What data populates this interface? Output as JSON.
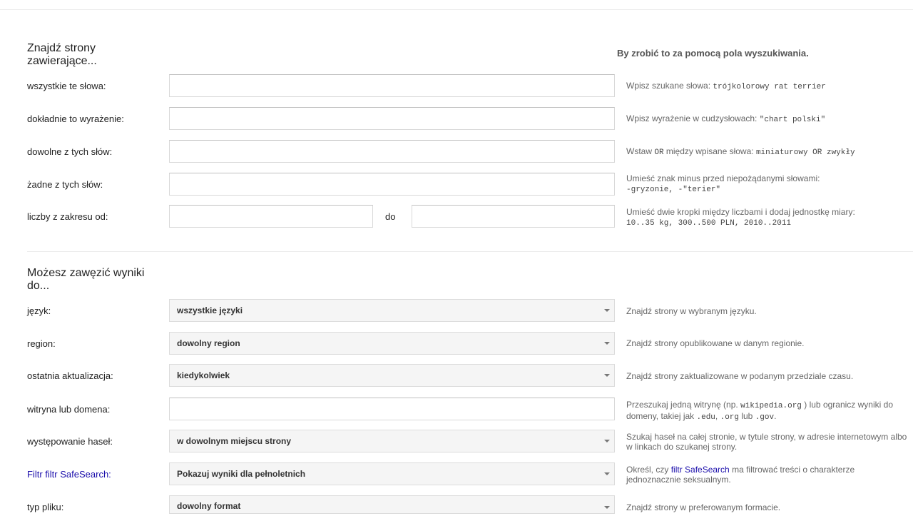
{
  "section1": {
    "title": "Znajdź strony zawierające...",
    "right_title": "By zrobić to za pomocą pola wyszukiwania.",
    "rows": [
      {
        "label": "wszystkie te słowa:",
        "hint_text": "Wpisz szukane słowa:",
        "hint_code": "trójkolorowy rat terrier"
      },
      {
        "label": "dokładnie to wyrażenie:",
        "hint_text": "Wpisz wyrażenie w cudzysłowach:",
        "hint_code": "\"chart polski\""
      },
      {
        "label": "dowolne z tych słów:",
        "hint_pre": "Wstaw",
        "hint_or": "OR",
        "hint_text": "między wpisane słowa:",
        "hint_code": "miniaturowy OR zwykły"
      },
      {
        "label": "żadne z tych słów:",
        "hint_text": "Umieść znak minus przed niepożądanymi słowami:",
        "hint_code": "-gryzonie, -\"terier\""
      },
      {
        "label": "liczby z zakresu od:",
        "to_label": "do",
        "hint_text": "Umieść dwie kropki między liczbami i dodaj jednostkę miary:",
        "hint_code": "10..35 kg, 300..500 PLN, 2010..2011"
      }
    ]
  },
  "section2": {
    "title": "Możesz zawęzić wyniki do...",
    "language": {
      "label": "język:",
      "value": "wszystkie języki",
      "hint": "Znajdź strony w wybranym języku."
    },
    "region": {
      "label": "region:",
      "value": "dowolny region",
      "hint": "Znajdź strony opublikowane w danym regionie."
    },
    "last_update": {
      "label": "ostatnia aktualizacja:",
      "value": "kiedykolwiek",
      "hint": "Znajdź strony zaktualizowane w podanym przedziale czasu."
    },
    "site": {
      "label": "witryna lub domena:",
      "hint_a": "Przeszukaj jedną witrynę (np.",
      "hint_code1": "wikipedia.org",
      "hint_b": ") lub ogranicz wyniki do domeny, takiej jak",
      "hint_code2": ".edu",
      "hint_c": ",",
      "hint_code3": ".org",
      "hint_d": "lub",
      "hint_code4": ".gov",
      "hint_e": "."
    },
    "occurrence": {
      "label": "występowanie haseł:",
      "value": "w dowolnym miejscu strony",
      "hint": "Szukaj haseł na całej stronie, w tytule strony, w adresie internetowym albo w linkach do szukanej strony."
    },
    "safesearch": {
      "label_pre": "Filtr",
      "label_link": "filtr SafeSearch",
      "label_post": ":",
      "value": "Pokazuj wyniki dla pełnoletnich",
      "hint_a": "Określ, czy",
      "hint_link": "filtr SafeSearch",
      "hint_b": "ma filtrować treści o charakterze jednoznacznie seksualnym."
    },
    "file_type": {
      "label": "typ pliku:",
      "value": "dowolny format",
      "hint": "Znajdź strony w preferowanym formacie."
    }
  }
}
